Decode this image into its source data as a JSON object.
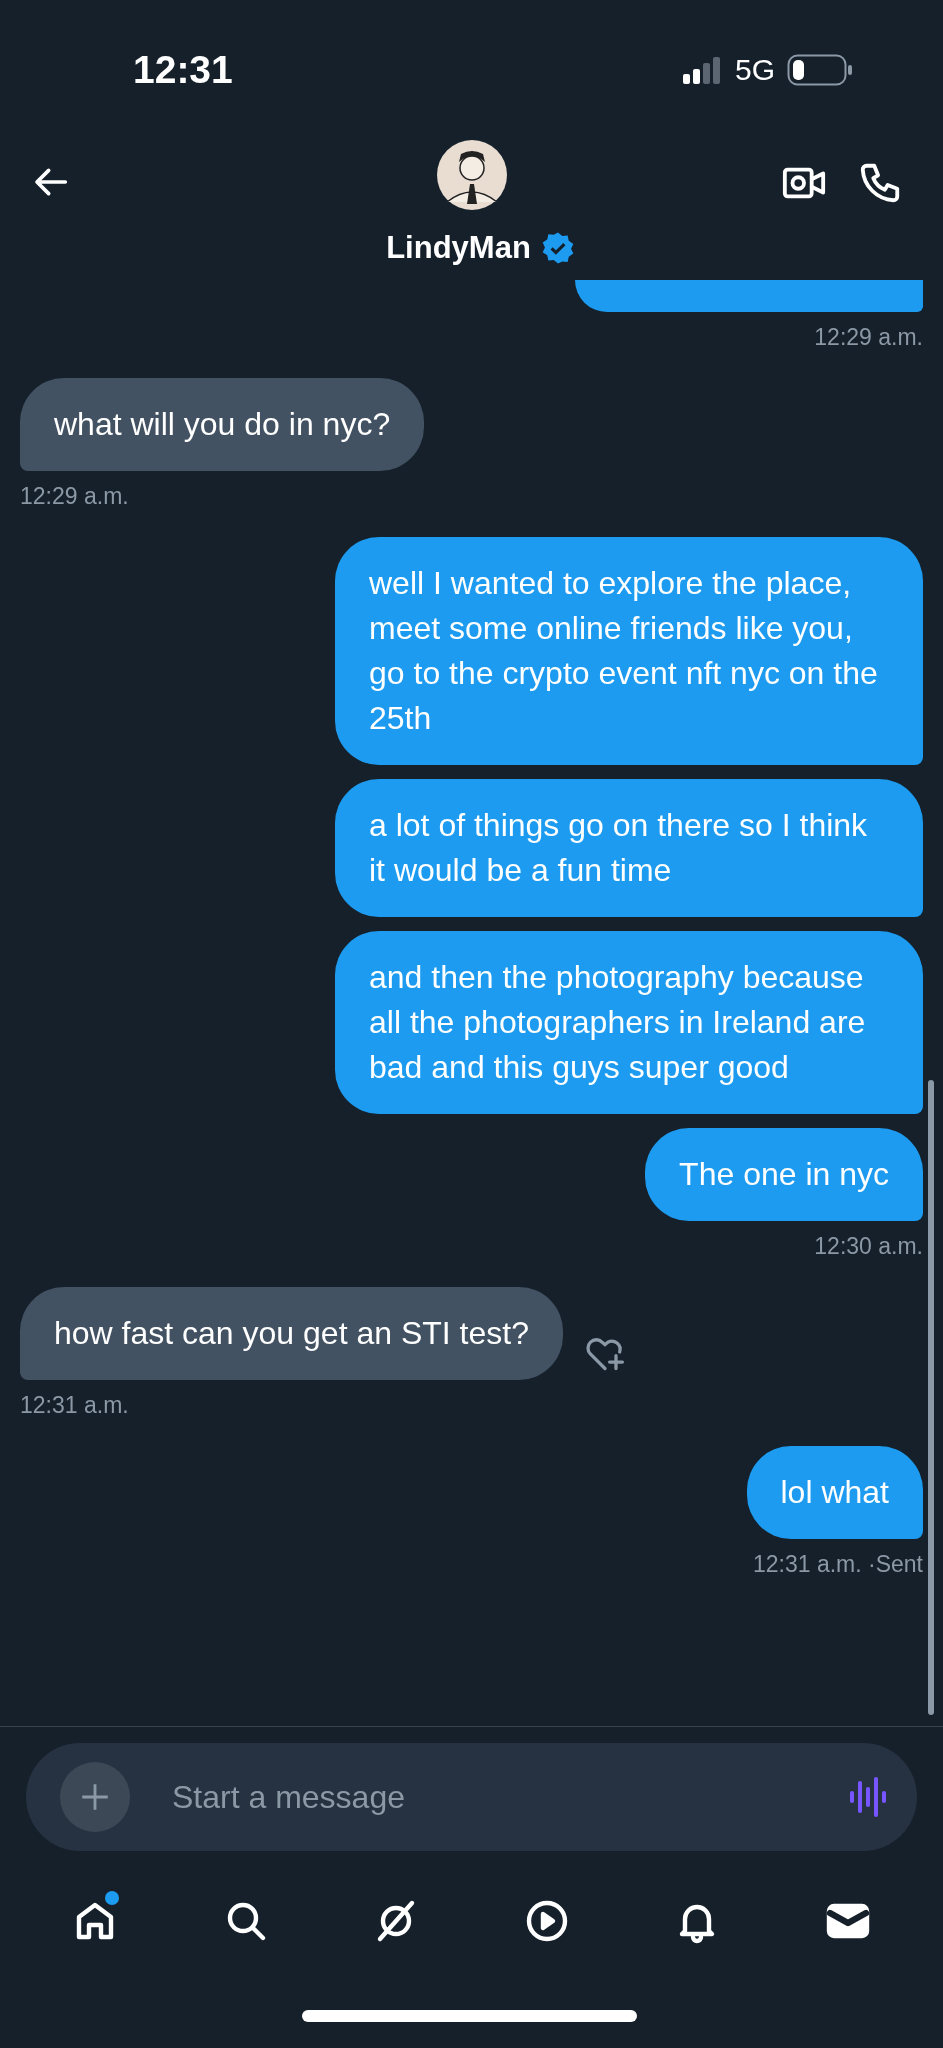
{
  "status_bar": {
    "time": "12:31",
    "network": "5G"
  },
  "header": {
    "name": "LindyMan",
    "verified": true
  },
  "messages": [
    {
      "kind": "cut",
      "time": "12:29 a.m."
    },
    {
      "kind": "received",
      "text": "what will you do in nyc?",
      "time": "12:29 a.m.",
      "react_button": false
    },
    {
      "kind": "sent",
      "text": "well I wanted to explore the place, meet some online friends like you, go to the crypto event nft nyc on the 25th"
    },
    {
      "kind": "sent",
      "text": "a lot of things go on there so I think it would be a fun time"
    },
    {
      "kind": "sent",
      "text": "and then the photography because all the photographers in Ireland are bad and this guys super good"
    },
    {
      "kind": "sent",
      "text": "The one in nyc",
      "time": "12:30 a.m."
    },
    {
      "kind": "received",
      "text": "how fast can you get an STI test?",
      "time": "12:31 a.m.",
      "react_button": true
    },
    {
      "kind": "sent",
      "text": "lol what",
      "time": "12:31 a.m. ·Sent"
    }
  ],
  "composer": {
    "placeholder": "Start a message"
  },
  "nav": [
    {
      "selected": false,
      "badge": true
    },
    {
      "selected": false,
      "badge": false
    },
    {
      "selected": false,
      "badge": false
    },
    {
      "selected": false,
      "badge": false
    },
    {
      "selected": false,
      "badge": false
    },
    {
      "selected": true,
      "badge": false
    }
  ]
}
